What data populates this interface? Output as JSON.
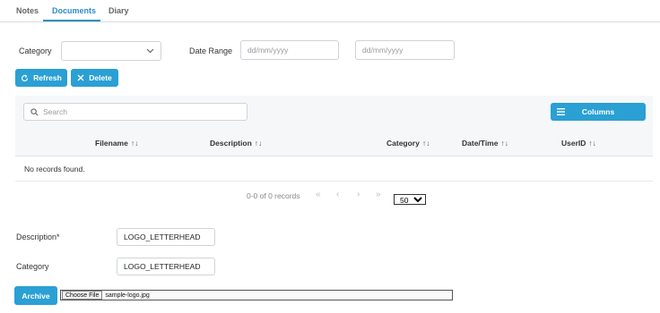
{
  "tabs": [
    {
      "label": "Notes"
    },
    {
      "label": "Documents"
    },
    {
      "label": "Diary"
    }
  ],
  "filters": {
    "category_label": "Category",
    "category_value": "",
    "date_range_label": "Date Range",
    "date_from_placeholder": "dd/mm/yyyy",
    "date_to_placeholder": "dd/mm/yyyy"
  },
  "toolbar": {
    "refresh_label": "Refresh",
    "delete_label": "Delete"
  },
  "grid": {
    "search_placeholder": "Search",
    "columns_button_label": "Columns",
    "headers": [
      {
        "label": "Filename",
        "sort": "↑↓"
      },
      {
        "label": "Description",
        "sort": "↑↓"
      },
      {
        "label": "Category",
        "sort": "↑↓"
      },
      {
        "label": "Date/Time",
        "sort": "↑↓"
      },
      {
        "label": "UserID",
        "sort": "↑↓"
      }
    ],
    "empty_message": "No records found."
  },
  "pager": {
    "summary": "0-0 of 0 records",
    "first_icon": "«",
    "prev_icon": "‹",
    "next_icon": "›",
    "last_icon": "»",
    "page_size": "50"
  },
  "upload": {
    "description_label": "Description*",
    "description_value": "LOGO_LETTERHEAD",
    "category_label": "Category",
    "category_value": "LOGO_LETTERHEAD",
    "archive_label": "Archive",
    "choose_file_label": "Choose File",
    "file_name": "sample-logo.jpg"
  },
  "colors": {
    "accent": "#2aa0d4",
    "tab_active": "#2d8ec9"
  }
}
